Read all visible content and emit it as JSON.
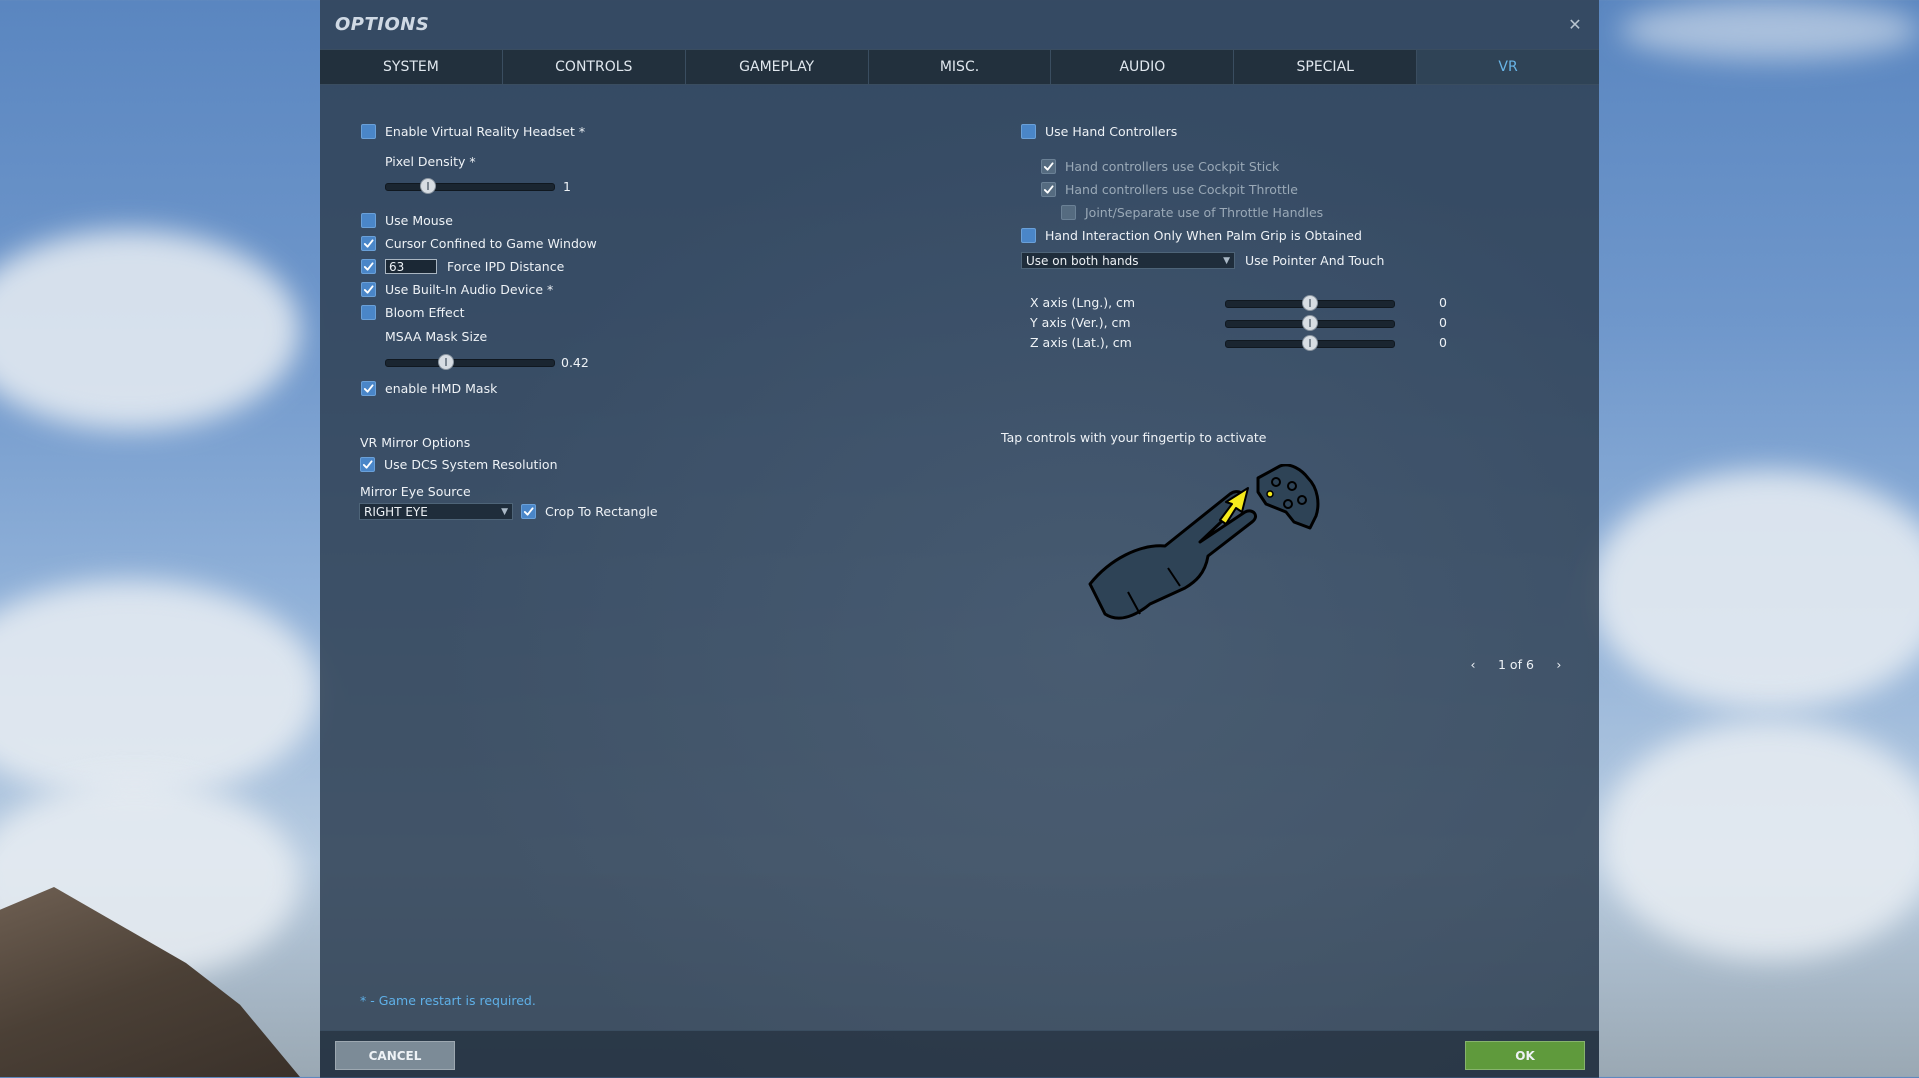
{
  "dialog": {
    "title": "OPTIONS",
    "close_label": "✕"
  },
  "tabs": [
    {
      "label": "SYSTEM"
    },
    {
      "label": "CONTROLS"
    },
    {
      "label": "GAMEPLAY"
    },
    {
      "label": "MISC."
    },
    {
      "label": "AUDIO"
    },
    {
      "label": "SPECIAL"
    },
    {
      "label": "VR"
    }
  ],
  "active_tab": "VR",
  "left": {
    "enable_vr": {
      "label": "Enable Virtual Reality Headset *",
      "checked": false
    },
    "pixel_density": {
      "label": "Pixel Density *",
      "value": "1",
      "fraction": 0.25
    },
    "use_mouse": {
      "label": "Use Mouse",
      "checked": false
    },
    "cursor_confined": {
      "label": "Cursor Confined to Game Window",
      "checked": true
    },
    "force_ipd": {
      "label": "Force IPD Distance",
      "checked": true,
      "value": "63"
    },
    "builtin_audio": {
      "label": "Use Built-In Audio Device *",
      "checked": true
    },
    "bloom": {
      "label": "Bloom Effect",
      "checked": false
    },
    "msaa_mask": {
      "label": "MSAA Mask Size",
      "value": "0.42",
      "fraction": 0.36
    },
    "hmd_mask": {
      "label": "enable HMD Mask",
      "checked": true
    },
    "mirror_title": "VR Mirror Options",
    "dcs_resolution": {
      "label": "Use DCS System Resolution",
      "checked": true
    },
    "mirror_eye_label": "Mirror Eye Source",
    "mirror_eye_value": "RIGHT EYE",
    "crop_rect": {
      "label": "Crop To Rectangle",
      "checked": true
    }
  },
  "right": {
    "hand_controllers": {
      "label": "Use Hand Controllers",
      "checked": false
    },
    "cockpit_stick": {
      "label": "Hand controllers use Cockpit Stick",
      "checked": true
    },
    "cockpit_throttle": {
      "label": "Hand controllers use Cockpit Throttle",
      "checked": true
    },
    "joint_throttle": {
      "label": "Joint/Separate use of Throttle Handles",
      "checked": false
    },
    "palm_grip": {
      "label": "Hand Interaction Only When Palm Grip is Obtained",
      "checked": false
    },
    "hands_select": "Use on both hands",
    "pointer_label": "Use Pointer And Touch",
    "axes": [
      {
        "label": "X axis (Lng.), cm",
        "value": "0",
        "fraction": 0.5
      },
      {
        "label": "Y axis (Ver.), cm",
        "value": "0",
        "fraction": 0.5
      },
      {
        "label": "Z axis (Lat.), cm",
        "value": "0",
        "fraction": 0.5
      }
    ],
    "tap_hint": "Tap controls with your fingertip to activate",
    "pager": "1 of 6"
  },
  "footer": {
    "note": "* - Game restart is required.",
    "cancel": "CANCEL",
    "ok": "OK"
  }
}
